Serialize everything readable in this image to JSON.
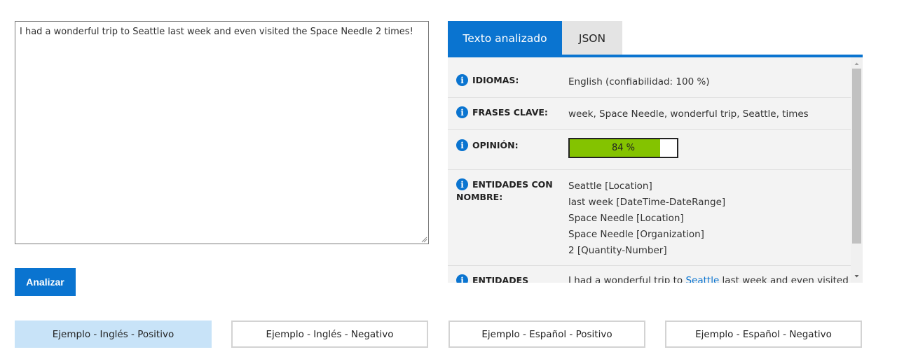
{
  "input": {
    "text": "I had a wonderful trip to Seattle last week and even visited the Space Needle 2 times!"
  },
  "analyze_button": {
    "label": "Analizar"
  },
  "tabs": [
    {
      "label": "Texto analizado",
      "active": true
    },
    {
      "label": "JSON",
      "active": false
    }
  ],
  "results": {
    "languages": {
      "label": "IDIOMAS:",
      "value": "English (confiabilidad: 100 %)"
    },
    "key_phrases": {
      "label": "FRASES CLAVE:",
      "value": "week, Space Needle, wonderful trip, Seattle, times"
    },
    "sentiment": {
      "label": "OPINIÓN:",
      "value_text": "84 %",
      "value": 0.84
    },
    "named_entities": {
      "label_line1": "ENTIDADES CON",
      "label_line2": "NOMBRE:",
      "items": [
        "Seattle [Location]",
        "last week [DateTime-DateRange]",
        "Space Needle [Location]",
        "Space Needle [Organization]",
        "2 [Quantity-Number]"
      ]
    },
    "linked_entities": {
      "label": "ENTIDADES",
      "value_pre": "I had a wonderful trip to ",
      "value_link": "Seattle",
      "value_post": " last week and even visited"
    }
  },
  "examples": [
    {
      "label": "Ejemplo - Inglés - Positivo",
      "selected": true
    },
    {
      "label": "Ejemplo - Inglés - Negativo",
      "selected": false
    },
    {
      "label": "Ejemplo - Español - Positivo",
      "selected": false
    },
    {
      "label": "Ejemplo - Español - Negativo",
      "selected": false
    }
  ],
  "colors": {
    "accent": "#0a74d0",
    "sentiment_fill": "#84c300",
    "selected_example": "#c8e3f8"
  },
  "icons": {
    "info": "info-icon",
    "resize": "resize-grip-icon",
    "scroll_up": "scroll-up-arrow-icon",
    "scroll_down": "scroll-down-arrow-icon"
  }
}
